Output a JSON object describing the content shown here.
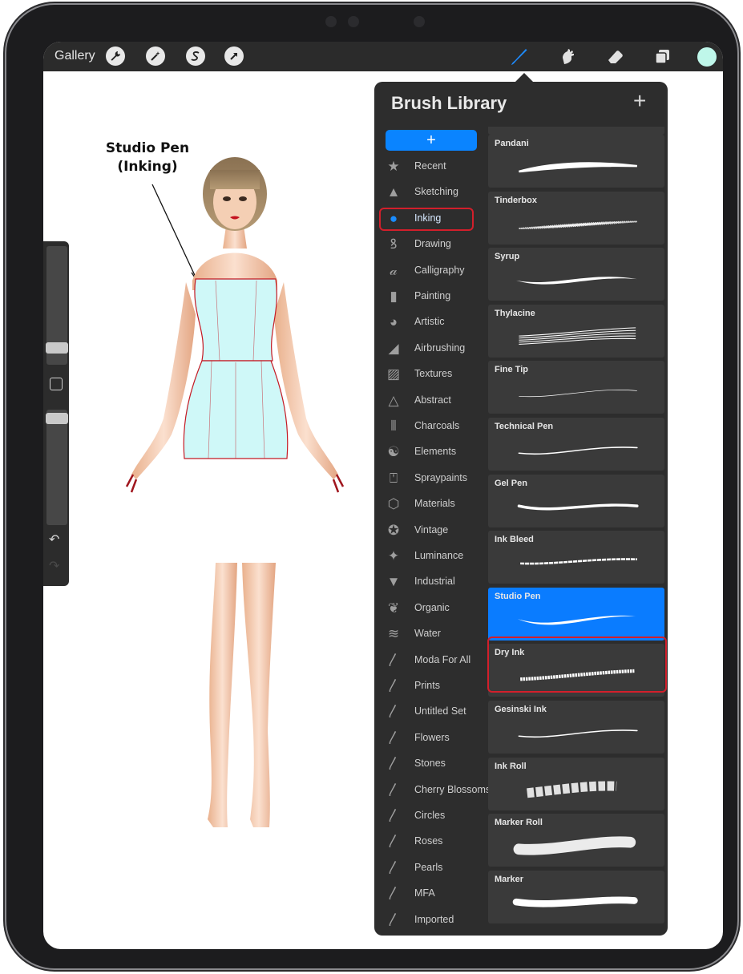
{
  "app": {
    "gallery_label": "Gallery",
    "toolbar_icons": [
      "wrench-icon",
      "magic-wand-icon",
      "selection-s-icon",
      "move-arrow-icon"
    ],
    "right_tools": [
      "brush-icon",
      "smudge-icon",
      "eraser-icon",
      "layers-icon"
    ],
    "current_color": "#bff7ea",
    "accent": "#0a84ff",
    "annotation_color": "#d21f2b"
  },
  "annotation": {
    "line1": "Studio Pen",
    "line2": "(Inking)"
  },
  "sidebar": {
    "undo_glyph": "↶",
    "redo_glyph": "↷"
  },
  "brush_library": {
    "title": "Brush Library",
    "add_glyph": "+",
    "active_set": "Inking",
    "sets": [
      {
        "label": "Recent",
        "icon": "star-icon",
        "glyph": "★"
      },
      {
        "label": "Sketching",
        "icon": "pencil-tip-icon",
        "glyph": "▲"
      },
      {
        "label": "Inking",
        "icon": "ink-drop-icon",
        "glyph": "●"
      },
      {
        "label": "Drawing",
        "icon": "swirl-icon",
        "glyph": "ꝸ"
      },
      {
        "label": "Calligraphy",
        "icon": "calligraphy-icon",
        "glyph": "𝒶"
      },
      {
        "label": "Painting",
        "icon": "paintbrush-icon",
        "glyph": "▮"
      },
      {
        "label": "Artistic",
        "icon": "palette-icon",
        "glyph": "◕"
      },
      {
        "label": "Airbrushing",
        "icon": "airbrush-icon",
        "glyph": "◢"
      },
      {
        "label": "Textures",
        "icon": "texture-icon",
        "glyph": "▨"
      },
      {
        "label": "Abstract",
        "icon": "triangle-icon",
        "glyph": "△"
      },
      {
        "label": "Charcoals",
        "icon": "charcoal-icon",
        "glyph": "⦀"
      },
      {
        "label": "Elements",
        "icon": "yin-yang-icon",
        "glyph": "☯"
      },
      {
        "label": "Spraypaints",
        "icon": "spray-can-icon",
        "glyph": "⍞"
      },
      {
        "label": "Materials",
        "icon": "cube-icon",
        "glyph": "⬡"
      },
      {
        "label": "Vintage",
        "icon": "vintage-star-icon",
        "glyph": "✪"
      },
      {
        "label": "Luminance",
        "icon": "sparkle-icon",
        "glyph": "✦"
      },
      {
        "label": "Industrial",
        "icon": "anvil-icon",
        "glyph": "▼"
      },
      {
        "label": "Organic",
        "icon": "leaf-icon",
        "glyph": "❦"
      },
      {
        "label": "Water",
        "icon": "waves-icon",
        "glyph": "≋"
      },
      {
        "label": "Moda For All",
        "icon": "brush-stroke-icon",
        "glyph": "〳"
      },
      {
        "label": "Prints",
        "icon": "brush-stroke-icon",
        "glyph": "〳"
      },
      {
        "label": "Untitled Set",
        "icon": "brush-stroke-icon",
        "glyph": "〳"
      },
      {
        "label": "Flowers",
        "icon": "brush-stroke-icon",
        "glyph": "〳"
      },
      {
        "label": "Stones",
        "icon": "brush-stroke-icon",
        "glyph": "〳"
      },
      {
        "label": "Cherry Blossoms",
        "icon": "brush-stroke-icon",
        "glyph": "〳"
      },
      {
        "label": "Circles",
        "icon": "brush-stroke-icon",
        "glyph": "〳"
      },
      {
        "label": "Roses",
        "icon": "brush-stroke-icon",
        "glyph": "〳"
      },
      {
        "label": "Pearls",
        "icon": "brush-stroke-icon",
        "glyph": "〳"
      },
      {
        "label": "MFA",
        "icon": "brush-stroke-icon",
        "glyph": "〳"
      },
      {
        "label": "Imported",
        "icon": "brush-stroke-icon",
        "glyph": "〳"
      }
    ],
    "brushes": [
      {
        "name": "",
        "stroke": "tapered"
      },
      {
        "name": "Pandani",
        "stroke": "rough"
      },
      {
        "name": "Tinderbox",
        "stroke": "grainy"
      },
      {
        "name": "Syrup",
        "stroke": "smooth-thick"
      },
      {
        "name": "Thylacine",
        "stroke": "multi-line"
      },
      {
        "name": "Fine Tip",
        "stroke": "hairline"
      },
      {
        "name": "Technical Pen",
        "stroke": "thin-swash"
      },
      {
        "name": "Gel Pen",
        "stroke": "round-thick"
      },
      {
        "name": "Ink Bleed",
        "stroke": "bleed"
      },
      {
        "name": "Studio Pen",
        "stroke": "swash",
        "selected": true
      },
      {
        "name": "Dry Ink",
        "stroke": "dry"
      },
      {
        "name": "Gesinski Ink",
        "stroke": "thin-swash"
      },
      {
        "name": "Ink Roll",
        "stroke": "roll"
      },
      {
        "name": "Marker Roll",
        "stroke": "marker-roll"
      },
      {
        "name": "Marker",
        "stroke": "marker"
      }
    ]
  }
}
